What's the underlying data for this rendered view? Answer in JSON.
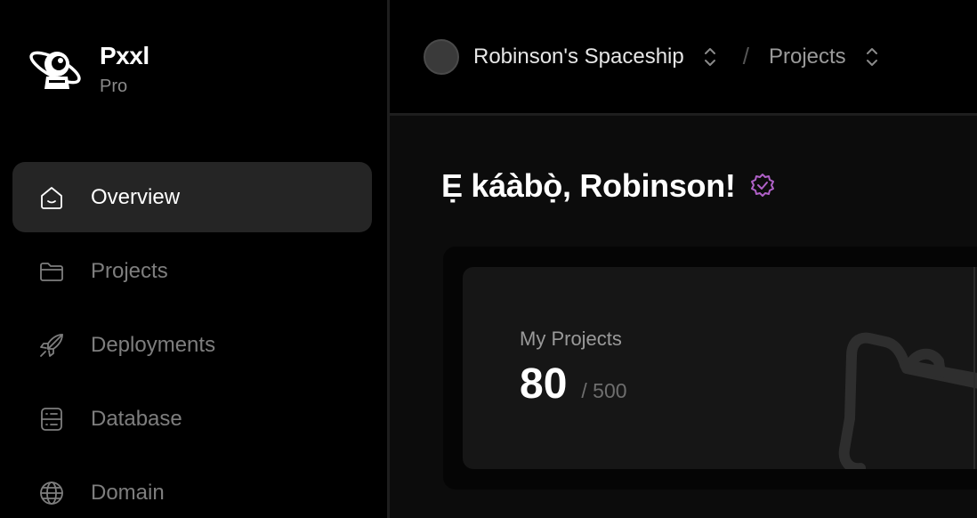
{
  "brand": {
    "name": "Pxxl",
    "plan": "Pro"
  },
  "nav": {
    "items": [
      {
        "label": "Overview",
        "icon": "home-icon",
        "active": true
      },
      {
        "label": "Projects",
        "icon": "folder-icon",
        "active": false
      },
      {
        "label": "Deployments",
        "icon": "rocket-icon",
        "active": false
      },
      {
        "label": "Database",
        "icon": "database-icon",
        "active": false
      },
      {
        "label": "Domain",
        "icon": "globe-icon",
        "active": false
      }
    ]
  },
  "topbar": {
    "workspace": "Robinson's Spaceship",
    "separator": "/",
    "section": "Projects"
  },
  "main": {
    "greeting": "Ẹ káàbọ̀, Robinson!",
    "verified_color": "#b061c8"
  },
  "card": {
    "label": "My Projects",
    "value": "80",
    "max": "/ 500"
  }
}
